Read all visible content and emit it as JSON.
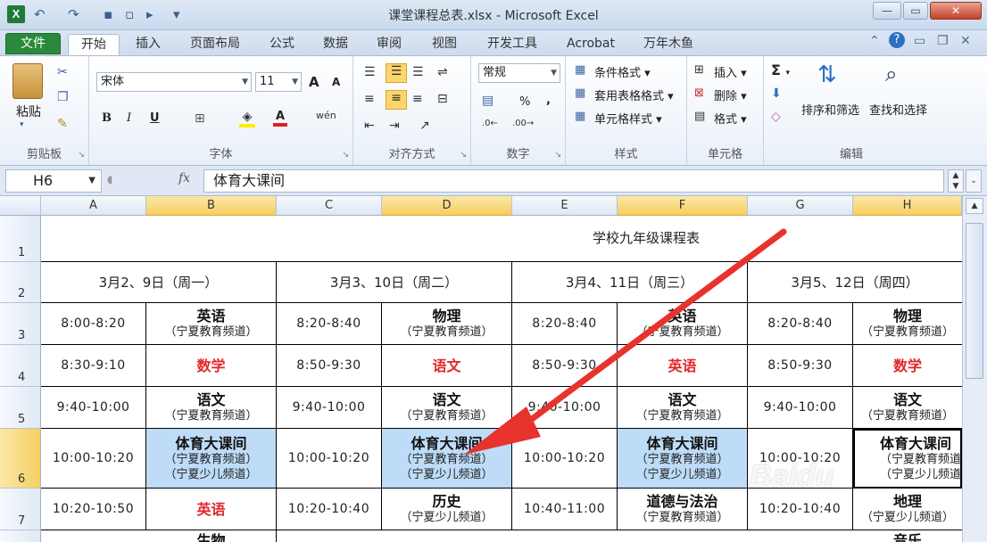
{
  "window": {
    "title": "课堂课程总表.xlsx - Microsoft Excel",
    "app_icon": "X",
    "minimize": "—",
    "maximize": "▭",
    "close": "✕"
  },
  "quick_access": {
    "undo": "↶",
    "redo": "↷",
    "save": "▪",
    "new": "▫",
    "open": "▸",
    "customize": "▾"
  },
  "tabs": [
    "文件",
    "开始",
    "插入",
    "页面布局",
    "公式",
    "数据",
    "审阅",
    "视图",
    "开发工具",
    "Acrobat",
    "万年木鱼"
  ],
  "active_tab": "开始",
  "ribbon": {
    "clipboard": {
      "label": "剪贴板",
      "paste": "粘贴"
    },
    "font": {
      "label": "字体",
      "name": "宋体",
      "size": "11",
      "bold": "B",
      "italic": "I",
      "underline": "U",
      "grow": "A",
      "shrink": "A",
      "wen": "wén"
    },
    "alignment": {
      "label": "对齐方式"
    },
    "number": {
      "label": "数字",
      "format": "常规",
      "percent": "%",
      "comma": ","
    },
    "styles": {
      "label": "样式",
      "conditional": "条件格式",
      "table": "套用表格格式",
      "cell": "单元格样式"
    },
    "cells": {
      "label": "单元格",
      "insert": "插入",
      "delete": "删除",
      "format": "格式"
    },
    "editing": {
      "label": "编辑",
      "sigma": "Σ",
      "sort": "排序和筛选",
      "find": "查找和选择"
    }
  },
  "formula_bar": {
    "name_box": "H6",
    "fx": "fx",
    "value": "体育大课间"
  },
  "columns": [
    "A",
    "B",
    "C",
    "D",
    "E",
    "F",
    "G",
    "H"
  ],
  "selected_columns": [
    "B",
    "D",
    "F",
    "H"
  ],
  "rows": [
    "1",
    "2",
    "3",
    "4",
    "5",
    "6",
    "7"
  ],
  "selected_row": "6",
  "sheet": {
    "title": "学校九年级课程表",
    "days": [
      "3月2、9日（周一）",
      "3月3、10日（周二）",
      "3月4、11日（周三）",
      "3月5、12日（周四）"
    ],
    "row3": {
      "times": [
        "8:00-8:20",
        "8:20-8:40",
        "8:20-8:40",
        "8:20-8:40"
      ],
      "subjects": [
        "英语",
        "物理",
        "英语",
        "物理"
      ],
      "channels": [
        "（宁夏教育频道）",
        "（宁夏教育频道）",
        "（宁夏教育频道）",
        "（宁夏教育频道）"
      ]
    },
    "row4": {
      "times": [
        "8:30-9:10",
        "8:50-9:30",
        "8:50-9:30",
        "8:50-9:30"
      ],
      "subjects": [
        "数学",
        "语文",
        "英语",
        "数学"
      ]
    },
    "row5": {
      "times": [
        "9:40-10:00",
        "9:40-10:00",
        "9:40-10:00",
        "9:40-10:00"
      ],
      "subjects": [
        "语文",
        "语文",
        "语文",
        "语文"
      ],
      "channels": [
        "（宁夏教育频道）",
        "（宁夏教育频道）",
        "（宁夏教育频道）",
        "（宁夏教育频道）"
      ]
    },
    "row6": {
      "times": [
        "10:00-10:20",
        "10:00-10:20",
        "10:00-10:20",
        "10:00-10:20"
      ],
      "subjects": [
        "体育大课间",
        "体育大课间",
        "体育大课间",
        "体育大课间"
      ],
      "channel1": "（宁夏教育频道）",
      "channel2": "（宁夏少儿频道）"
    },
    "row7": {
      "times": [
        "10:20-10:50",
        "10:20-10:40",
        "10:40-11:00",
        "10:20-10:40"
      ],
      "subjects": [
        "英语",
        "历史",
        "道德与法治",
        "地理"
      ],
      "channels": [
        "",
        "（宁夏少儿频道）",
        "（宁夏教育频道）",
        "（宁夏少儿频道）"
      ]
    },
    "row8_partial": [
      "生物",
      "音乐"
    ]
  },
  "watermark": "Baidu"
}
